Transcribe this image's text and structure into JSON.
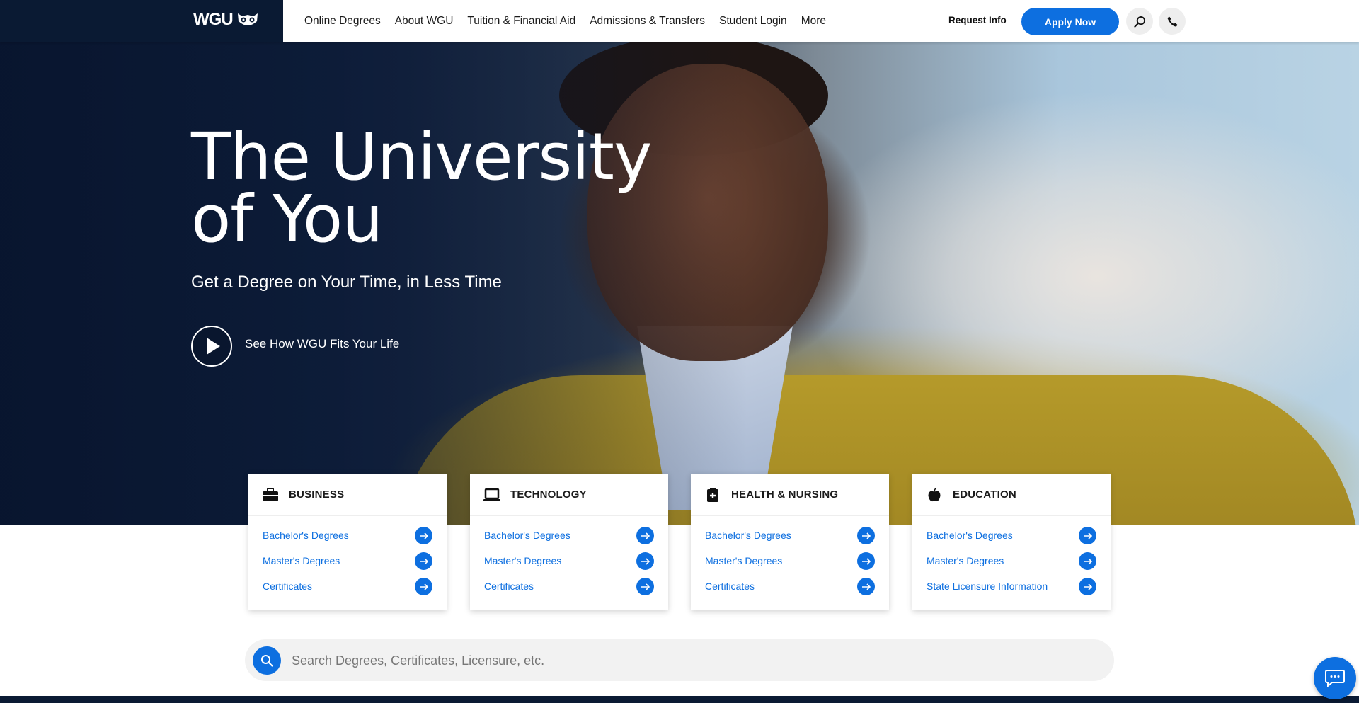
{
  "header": {
    "logo_text": "WGU",
    "nav": [
      "Online Degrees",
      "About WGU",
      "Tuition & Financial Aid",
      "Admissions & Transfers",
      "Student Login",
      "More"
    ],
    "request_info": "Request Info",
    "apply_now": "Apply Now"
  },
  "hero": {
    "title_line1": "The University",
    "title_line2": "of You",
    "subtitle": "Get a Degree on Your Time, in Less Time",
    "video_link": "See How WGU Fits Your Life"
  },
  "categories": [
    {
      "title": "BUSINESS",
      "icon": "briefcase-icon",
      "links": [
        "Bachelor's Degrees",
        "Master's Degrees",
        "Certificates"
      ]
    },
    {
      "title": "TECHNOLOGY",
      "icon": "laptop-icon",
      "links": [
        "Bachelor's Degrees",
        "Master's Degrees",
        "Certificates"
      ]
    },
    {
      "title": "HEALTH & NURSING",
      "icon": "medical-bag-icon",
      "links": [
        "Bachelor's Degrees",
        "Master's Degrees",
        "Certificates"
      ]
    },
    {
      "title": "EDUCATION",
      "icon": "apple-icon",
      "links": [
        "Bachelor's Degrees",
        "Master's Degrees",
        "State Licensure Information"
      ]
    }
  ],
  "search": {
    "placeholder": "Search Degrees, Certificates, Licensure, etc."
  },
  "colors": {
    "accent": "#0d6fe0",
    "navy": "#0a1a33"
  }
}
